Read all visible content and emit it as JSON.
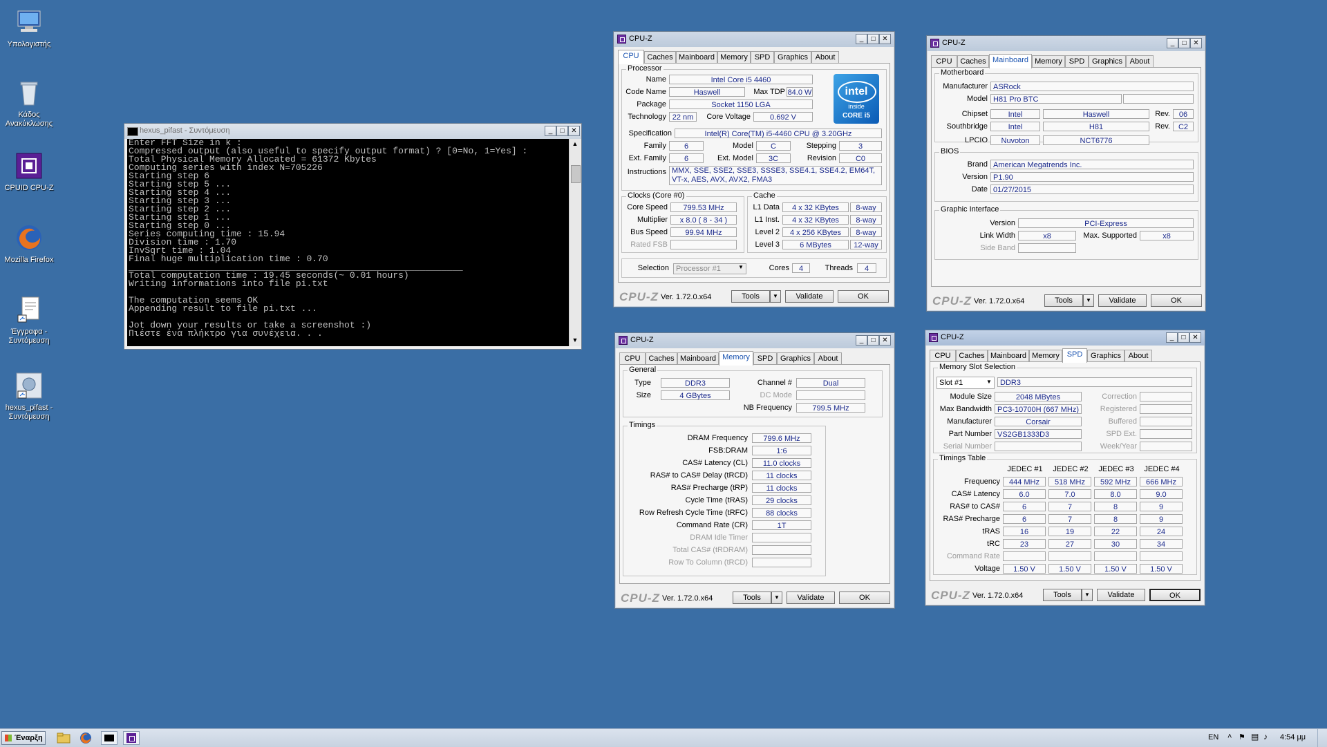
{
  "desktop": {
    "icons": [
      {
        "label": "Υπολογιστής"
      },
      {
        "label": "Κάδος Ανακύκλωσης"
      },
      {
        "label": "CPUID CPU-Z"
      },
      {
        "label": "Mozilla Firefox"
      },
      {
        "label": "Έγγραφα - Συντόμευση"
      },
      {
        "label": "hexus_pifast - Συντόμευση"
      }
    ]
  },
  "console": {
    "title": "hexus_pifast - Συντόμευση",
    "lines": [
      "Enter FFT Size in k :",
      "Compressed output (also useful to specify output format) ? [0=No, 1=Yes] :",
      "Total Physical Memory Allocated = 61372 Kbytes",
      "Computing series with index N=705226",
      "Starting step 6",
      "Starting step 5 ...",
      "Starting step 4 ...",
      "Starting step 3 ...",
      "Starting step 2 ...",
      "Starting step 1 ...",
      "Starting step 0 ...",
      "Series computing time : 15.94",
      "Division time : 1.70",
      "InvSqrt time : 1.04",
      "Final huge multiplication time : 0.70",
      "______________________________________________________________",
      "Total computation time : 19.45 seconds(~ 0.01 hours)",
      "Writing informations into file pi.txt",
      "",
      "The computation seems OK",
      "Appending result to file pi.txt ...",
      "",
      "Jot down your results or take a screenshot :)",
      "Πιέστε ένα πλήκτρο για συνέχεια. . ."
    ]
  },
  "cpuz_common": {
    "title": "CPU-Z",
    "tabs": [
      "CPU",
      "Caches",
      "Mainboard",
      "Memory",
      "SPD",
      "Graphics",
      "About"
    ],
    "logo": "CPU-Z",
    "version": "Ver. 1.72.0.x64",
    "tools": "Tools",
    "validate": "Validate",
    "ok": "OK"
  },
  "cpu_tab": {
    "processor_group": "Processor",
    "name_l": "Name",
    "name": "Intel Core i5 4460",
    "codename_l": "Code Name",
    "codename": "Haswell",
    "maxtdp_l": "Max TDP",
    "maxtdp": "84.0 W",
    "package_l": "Package",
    "package": "Socket 1150 LGA",
    "tech_l": "Technology",
    "tech": "22 nm",
    "voltage_l": "Core Voltage",
    "voltage": "0.692 V",
    "spec_l": "Specification",
    "spec": "Intel(R) Core(TM) i5-4460  CPU @ 3.20GHz",
    "family_l": "Family",
    "family": "6",
    "model_l": "Model",
    "model": "C",
    "stepping_l": "Stepping",
    "stepping": "3",
    "extfamily_l": "Ext. Family",
    "extfamily": "6",
    "extmodel_l": "Ext. Model",
    "extmodel": "3C",
    "revision_l": "Revision",
    "revision": "C0",
    "instr_l": "Instructions",
    "instr1": "MMX, SSE, SSE2, SSE3, SSSE3, SSE4.1, SSE4.2, EM64T,",
    "instr2": "VT-x, AES, AVX, AVX2, FMA3",
    "clocks_group": "Clocks (Core #0)",
    "corespeed_l": "Core Speed",
    "corespeed": "799.53 MHz",
    "mult_l": "Multiplier",
    "mult": "x 8.0 ( 8 - 34 )",
    "bus_l": "Bus Speed",
    "bus": "99.94 MHz",
    "fsb_l": "Rated FSB",
    "fsb": "",
    "cache_group": "Cache",
    "l1d_l": "L1 Data",
    "l1d": "4 x 32 KBytes",
    "l1d_w": "8-way",
    "l1i_l": "L1 Inst.",
    "l1i": "4 x 32 KBytes",
    "l1i_w": "8-way",
    "l2_l": "Level 2",
    "l2": "4 x 256 KBytes",
    "l2_w": "8-way",
    "l3_l": "Level 3",
    "l3": "6 MBytes",
    "l3_w": "12-way",
    "selection_l": "Selection",
    "selection": "Processor #1",
    "cores_l": "Cores",
    "cores": "4",
    "threads_l": "Threads",
    "threads": "4",
    "badge": {
      "brand": "intel",
      "inside": "inside",
      "line": "CORE i5"
    }
  },
  "mainboard_tab": {
    "mb_group": "Motherboard",
    "manuf_l": "Manufacturer",
    "manuf": "ASRock",
    "model_l": "Model",
    "model": "H81 Pro BTC",
    "chipset_l": "Chipset",
    "chipset1": "Intel",
    "chipset2": "Haswell",
    "chipset_rev_l": "Rev.",
    "chipset_rev": "06",
    "south_l": "Southbridge",
    "south1": "Intel",
    "south2": "H81",
    "south_rev_l": "Rev.",
    "south_rev": "C2",
    "lpcio_l": "LPCIO",
    "lpcio1": "Nuvoton",
    "lpcio2": "NCT6776",
    "bios_group": "BIOS",
    "brand_l": "Brand",
    "brand": "American Megatrends Inc.",
    "version_l": "Version",
    "version": "P1.90",
    "date_l": "Date",
    "date": "01/27/2015",
    "gi_group": "Graphic Interface",
    "giver_l": "Version",
    "giver": "PCI-Express",
    "lw_l": "Link Width",
    "lw": "x8",
    "maxsup_l": "Max. Supported",
    "maxsup": "x8",
    "sideband_l": "Side Band"
  },
  "memory_tab": {
    "general_group": "General",
    "type_l": "Type",
    "type": "DDR3",
    "size_l": "Size",
    "size": "4 GBytes",
    "channel_l": "Channel #",
    "channel": "Dual",
    "dcmode_l": "DC Mode",
    "nbfreq_l": "NB Frequency",
    "nbfreq": "799.5 MHz",
    "timings_group": "Timings",
    "rows": [
      {
        "label": "DRAM Frequency",
        "value": "799.6 MHz",
        "dim": false
      },
      {
        "label": "FSB:DRAM",
        "value": "1:6",
        "dim": false
      },
      {
        "label": "CAS# Latency (CL)",
        "value": "11.0 clocks",
        "dim": false
      },
      {
        "label": "RAS# to CAS# Delay (tRCD)",
        "value": "11 clocks",
        "dim": false
      },
      {
        "label": "RAS# Precharge (tRP)",
        "value": "11 clocks",
        "dim": false
      },
      {
        "label": "Cycle Time (tRAS)",
        "value": "29 clocks",
        "dim": false
      },
      {
        "label": "Row Refresh Cycle Time (tRFC)",
        "value": "88 clocks",
        "dim": false
      },
      {
        "label": "Command Rate (CR)",
        "value": "1T",
        "dim": false
      },
      {
        "label": "DRAM Idle Timer",
        "value": "",
        "dim": true
      },
      {
        "label": "Total CAS# (tRDRAM)",
        "value": "",
        "dim": true
      },
      {
        "label": "Row To Column (tRCD)",
        "value": "",
        "dim": true
      }
    ]
  },
  "spd_tab": {
    "slot_group": "Memory Slot Selection",
    "slot": "Slot #1",
    "slot_type": "DDR3",
    "modsize_l": "Module Size",
    "modsize": "2048 MBytes",
    "correction_l": "Correction",
    "maxbw_l": "Max Bandwidth",
    "maxbw": "PC3-10700H (667 MHz)",
    "registered_l": "Registered",
    "manuf_l": "Manufacturer",
    "manuf": "Corsair",
    "buffered_l": "Buffered",
    "part_l": "Part Number",
    "part": "VS2GB1333D3",
    "spdext_l": "SPD Ext.",
    "serial_l": "Serial Number",
    "weekyear_l": "Week/Year",
    "timings_group": "Timings Table",
    "headers": [
      "JEDEC #1",
      "JEDEC #2",
      "JEDEC #3",
      "JEDEC #4"
    ],
    "rows": [
      {
        "label": "Frequency",
        "dim": false,
        "cells": [
          "444 MHz",
          "518 MHz",
          "592 MHz",
          "666 MHz"
        ]
      },
      {
        "label": "CAS# Latency",
        "dim": false,
        "cells": [
          "6.0",
          "7.0",
          "8.0",
          "9.0"
        ]
      },
      {
        "label": "RAS# to CAS#",
        "dim": false,
        "cells": [
          "6",
          "7",
          "8",
          "9"
        ]
      },
      {
        "label": "RAS# Precharge",
        "dim": false,
        "cells": [
          "6",
          "7",
          "8",
          "9"
        ]
      },
      {
        "label": "tRAS",
        "dim": false,
        "cells": [
          "16",
          "19",
          "22",
          "24"
        ]
      },
      {
        "label": "tRC",
        "dim": false,
        "cells": [
          "23",
          "27",
          "30",
          "34"
        ]
      },
      {
        "label": "Command Rate",
        "dim": true,
        "cells": [
          "",
          "",
          "",
          ""
        ]
      },
      {
        "label": "Voltage",
        "dim": false,
        "cells": [
          "1.50 V",
          "1.50 V",
          "1.50 V",
          "1.50 V"
        ]
      }
    ]
  },
  "taskbar": {
    "start": "Έναρξη",
    "lang": "EN",
    "clock": "4:54 μμ"
  }
}
